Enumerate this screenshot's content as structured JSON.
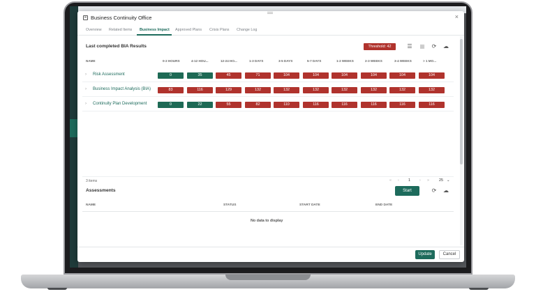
{
  "dialog": {
    "title": "Business Continuity Office",
    "close_glyph": "×",
    "icon": "window-icon"
  },
  "tabs": [
    "Overview",
    "Related Items",
    "Business Impact",
    "Approved Plans",
    "Crisis Plans",
    "Change Log"
  ],
  "active_tab": "Business Impact",
  "bia": {
    "title": "Last completed BIA Results",
    "threshold": "Threshold: 42",
    "icons": [
      "list-icon",
      "grid-icon",
      "refresh-icon",
      "cloud-download-icon"
    ],
    "columns": [
      "NAME",
      "0-2 HOURS",
      "4-12 HOU...",
      "12-24 HO...",
      "1-3 DAYS",
      "3-5 DAYS",
      "5-7 DAYS",
      "1-2 WEEKS",
      "2-3 WEEKS",
      "3-4 WEEKS",
      "> 1 MO..."
    ],
    "rows": [
      {
        "name": "Risk Assessment",
        "values": [
          "0",
          "35",
          "45",
          "71",
          "104",
          "104",
          "104",
          "104",
          "104",
          "104"
        ]
      },
      {
        "name": "Business Impact Analysis (BIA)",
        "values": [
          "83",
          "116",
          "129",
          "132",
          "132",
          "132",
          "132",
          "132",
          "132",
          "132"
        ]
      },
      {
        "name": "Continuity Plan Development",
        "values": [
          "0",
          "22",
          "55",
          "82",
          "110",
          "116",
          "116",
          "116",
          "116",
          "116"
        ]
      }
    ],
    "below_threshold_color": "#1e6a55",
    "above_threshold_color": "#b0332d",
    "items_count": "3 items",
    "page": "1",
    "page_size": "25"
  },
  "assessments": {
    "title": "Assessments",
    "start_label": "Start",
    "columns": [
      "NAME",
      "STATUS",
      "START DATE",
      "END DATE"
    ],
    "empty_text": "No data to display"
  },
  "footer": {
    "update_label": "Update",
    "cancel_label": "Cancel"
  },
  "accent_color": "#1d6b5c"
}
